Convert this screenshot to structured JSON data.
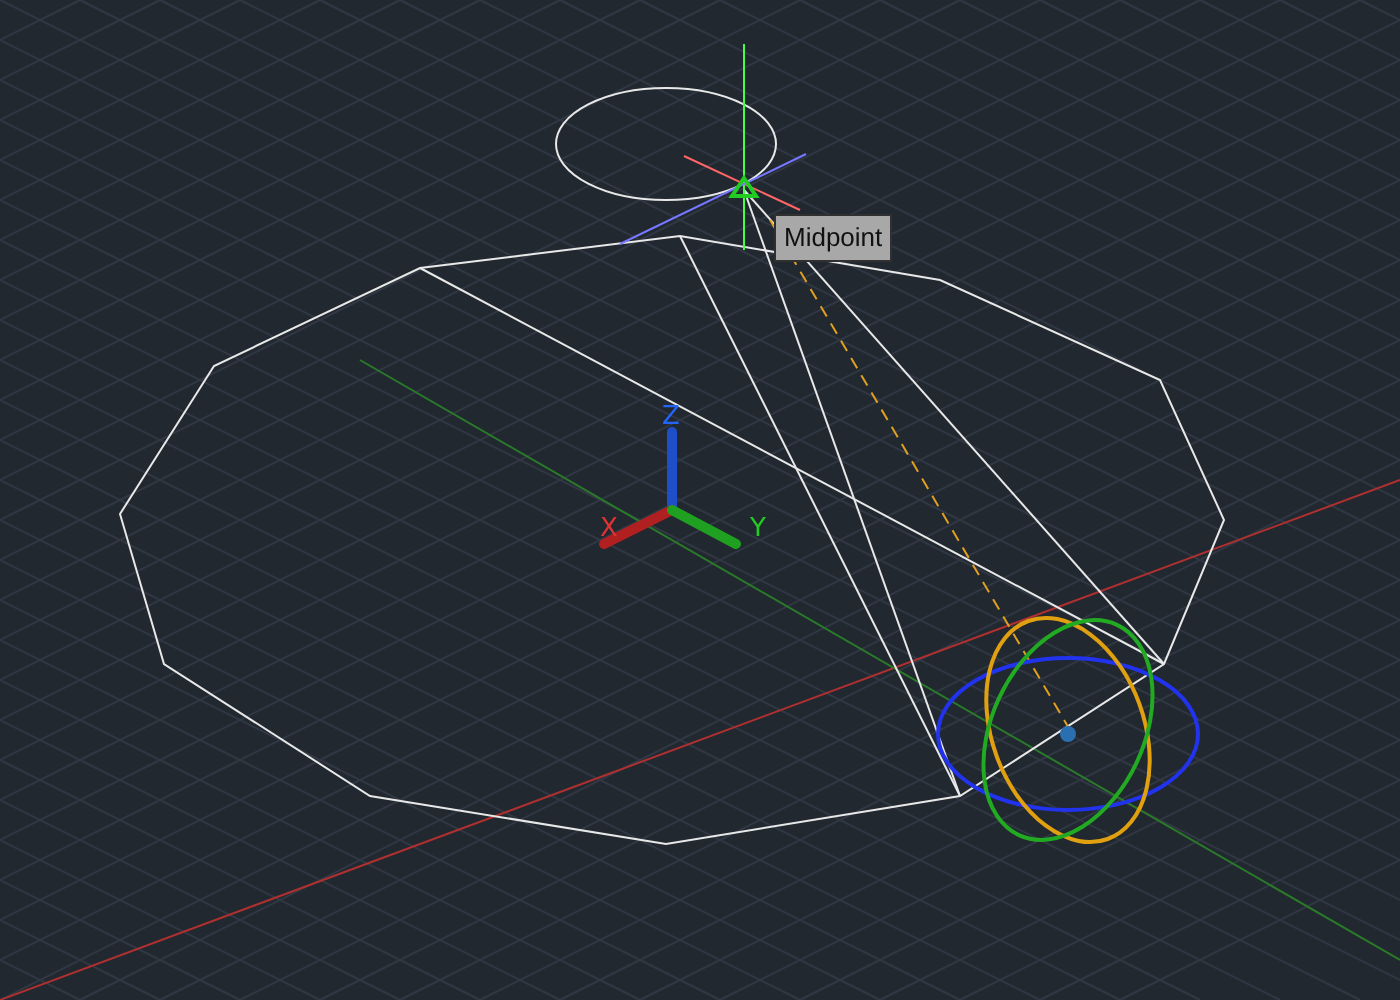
{
  "viewport": {
    "tooltip": "Midpoint",
    "ucs_axes": [
      {
        "kind": "x",
        "label": "X"
      },
      {
        "kind": "y",
        "label": "Y"
      },
      {
        "kind": "z",
        "label": "Z"
      }
    ]
  }
}
